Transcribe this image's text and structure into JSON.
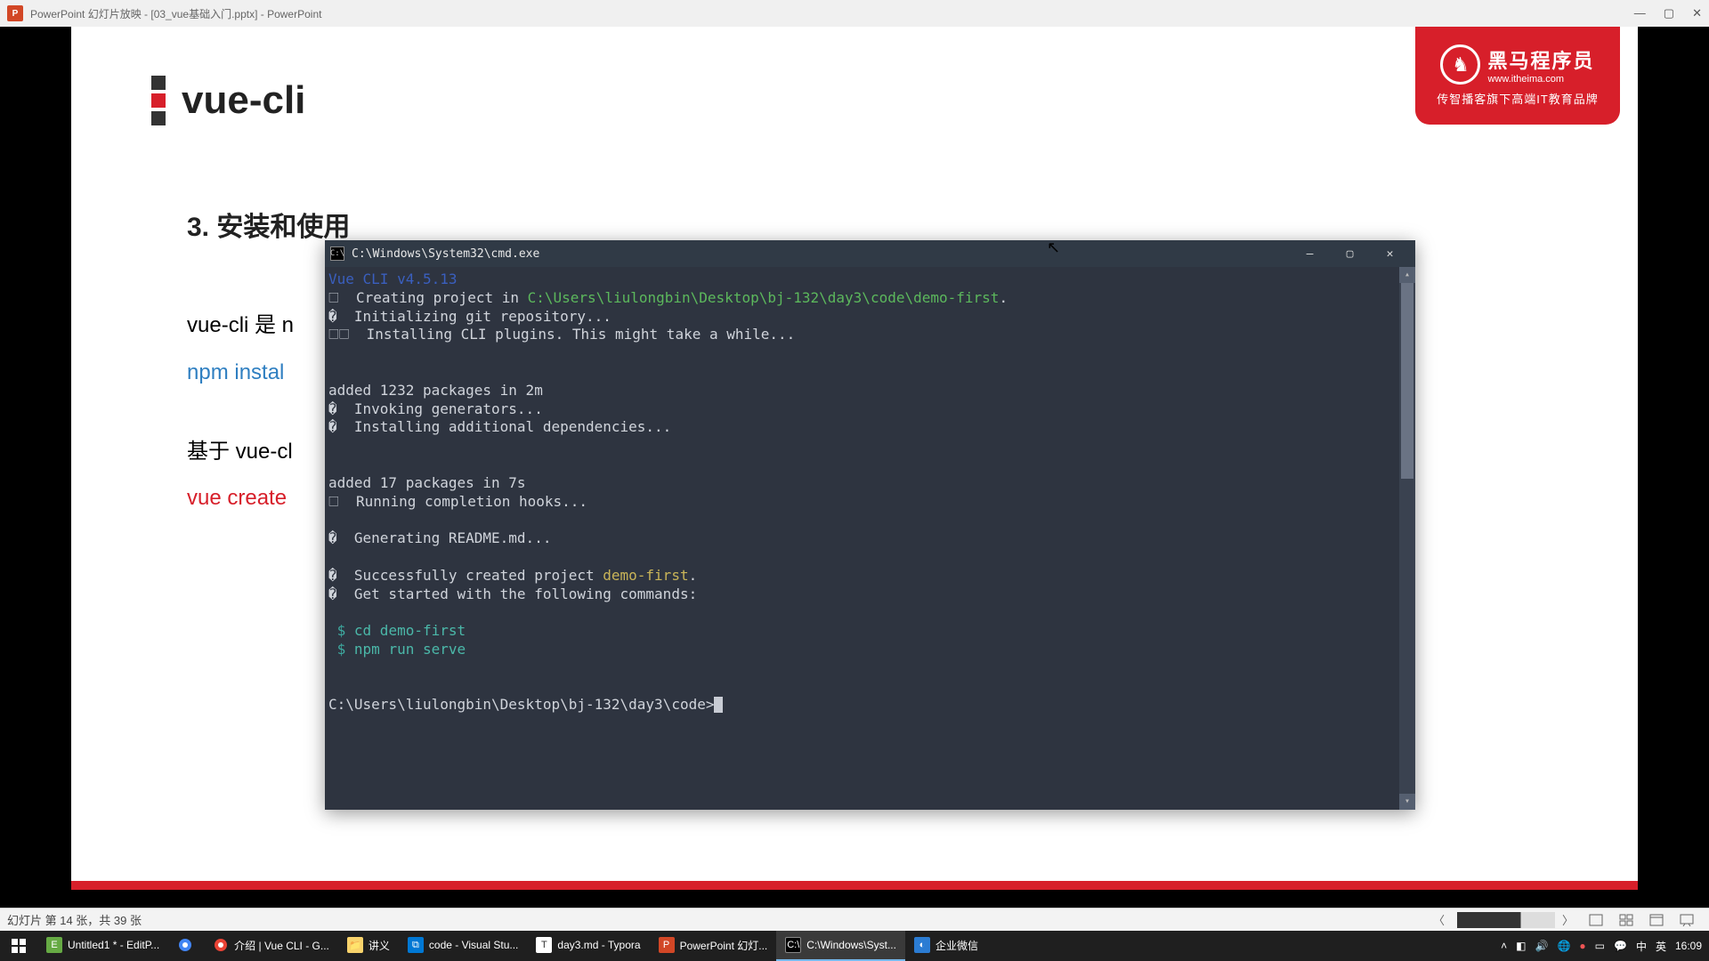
{
  "ppt": {
    "titlebar": "PowerPoint 幻灯片放映 - [03_vue基础入门.pptx] - PowerPoint",
    "status": "幻灯片 第 14 张，共 39 张"
  },
  "slide": {
    "title": "vue-cli",
    "h3": "3. 安装和使用",
    "line1_a": "vue-cli 是 n",
    "line2": "npm instal",
    "line3_a": "基于 vue-cl",
    "line4": "vue create",
    "logo_main": "黑马程序员",
    "logo_url": "www.itheima.com",
    "logo_sub": "传智播客旗下高端IT教育品牌"
  },
  "terminal": {
    "title": "C:\\Windows\\System32\\cmd.exe",
    "l0": "Vue CLI v4.5.13",
    "l1a": "🗆  Creating project in ",
    "l1b": "C:\\Users\\liulongbin\\Desktop\\bj-132\\day3\\code\\demo-first",
    "l1c": ".",
    "l2": "�  Initializing git repository...",
    "l3": "🗆🗆  Installing CLI plugins. This might take a while...",
    "l5": "added 1232 packages in 2m",
    "l6": "�  Invoking generators...",
    "l7": "�  Installing additional dependencies...",
    "l9": "added 17 packages in 7s",
    "l10": "🗆  Running completion hooks...",
    "l12": "�  Generating README.md...",
    "l14a": "�  Successfully created project ",
    "l14b": "demo-first",
    "l14c": ".",
    "l15": "�  Get started with the following commands:",
    "l17a": " $ ",
    "l17b": "cd demo-first",
    "l18a": " $ ",
    "l18b": "npm run serve",
    "prompt": "C:\\Users\\liulongbin\\Desktop\\bj-132\\day3\\code>"
  },
  "taskbar": {
    "t1": "Untitled1 * - EditP...",
    "t3": "介绍 | Vue CLI - G...",
    "t4": "讲义",
    "t5": "code - Visual Stu...",
    "t6": "day3.md - Typora",
    "t7": "PowerPoint 幻灯...",
    "t8": "C:\\Windows\\Syst...",
    "t9": "企业微信",
    "ime1": "中",
    "ime2": "英",
    "time": "16:09"
  }
}
